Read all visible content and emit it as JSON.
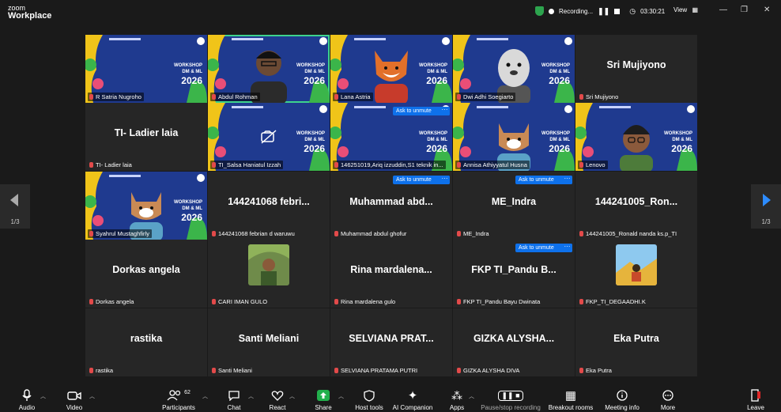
{
  "app": {
    "brand_small": "zoom",
    "brand_large": "Workplace"
  },
  "status": {
    "recording_label": "Recording...",
    "timer": "03:30:21",
    "view_label": "View"
  },
  "workshop": {
    "line1": "WORKSHOP",
    "line2": "DM & ML",
    "year": "2026"
  },
  "colors": {
    "accent_blue": "#0e71eb",
    "active_green": "#3ed38d",
    "muted_red": "#e24a4a",
    "slide_blue": "#1f3a8f"
  },
  "pager": {
    "left": "1/3",
    "right": "1/3"
  },
  "ask_to_unmute": "Ask to unmute",
  "participants_tiles": [
    {
      "name": "R Satria Nugroho",
      "display": ""
    },
    {
      "name": "Abdul Rohman",
      "display": ""
    },
    {
      "name": "Lana Astria",
      "display": ""
    },
    {
      "name": "Dwi Adhi Soegiarto",
      "display": ""
    },
    {
      "name": "Sri Mujiyono",
      "display": "Sri Mujiyono"
    },
    {
      "name": "TI- Ladier laia",
      "display": "TI- Ladier laia"
    },
    {
      "name": "TI_Salsa Haniatul Izzah",
      "display": ""
    },
    {
      "name": "146251019,Ariq izzuddin,S1 teknik in...",
      "display": ""
    },
    {
      "name": "Annisa Athiyyatul Husna",
      "display": ""
    },
    {
      "name": "Lenovo",
      "display": ""
    },
    {
      "name": "Syahrul Mustaghfirly",
      "display": ""
    },
    {
      "name": "144241068 febrian d waruwu",
      "display": "144241068  febri..."
    },
    {
      "name": "Muhammad abdul ghofur",
      "display": "Muhammad  abd..."
    },
    {
      "name": "ME_Indra",
      "display": "ME_Indra"
    },
    {
      "name": "144241005_Ronald nanda ks.p_TI",
      "display": "144241005_Ron..."
    },
    {
      "name": "Dorkas angela",
      "display": "Dorkas angela"
    },
    {
      "name": "CARI IMAN GULO",
      "display": ""
    },
    {
      "name": "Rina mardalena gulo",
      "display": "Rina  mardalena..."
    },
    {
      "name": "FKP TI_Pandu Bayu Dwinata",
      "display": "FKP  TI_Pandu  B..."
    },
    {
      "name": "FKP_TI_DEGAADHI.K",
      "display": ""
    },
    {
      "name": "rastika",
      "display": "rastika"
    },
    {
      "name": "Santi Meliani",
      "display": "Santi Meliani"
    },
    {
      "name": "SELVIANA PRATAMA PUTRI",
      "display": "SELVIANA  PRAT..."
    },
    {
      "name": "GIZKA ALYSHA DIVA",
      "display": "GIZKA  ALYSHA..."
    },
    {
      "name": "Eka Putra",
      "display": "Eka Putra"
    }
  ],
  "toolbar": {
    "audio": "Audio",
    "video": "Video",
    "participants": "Participants",
    "participants_count": "62",
    "chat": "Chat",
    "react": "React",
    "share": "Share",
    "host_tools": "Host tools",
    "ai_companion": "AI Companion",
    "apps": "Apps",
    "pause_recording": "Pause/stop recording",
    "breakout": "Breakout rooms",
    "meeting_info": "Meeting info",
    "more": "More",
    "leave": "Leave"
  }
}
